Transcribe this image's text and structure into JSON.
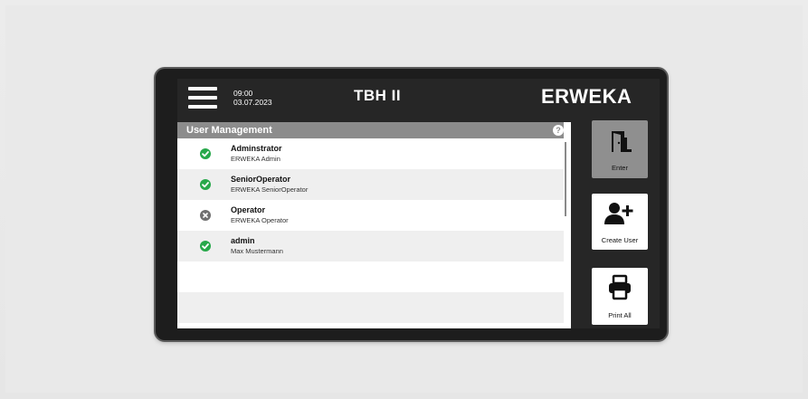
{
  "header": {
    "time": "09:00",
    "date": "03.07.2023",
    "title": "TBH II",
    "brand": "ERWEKA"
  },
  "list": {
    "title": "User Management",
    "help": "?",
    "users": [
      {
        "name": "Adminstrator",
        "role": "ERWEKA Admin",
        "status": "active"
      },
      {
        "name": "SeniorOperator",
        "role": "ERWEKA SeniorOperator",
        "status": "active"
      },
      {
        "name": "Operator",
        "role": "ERWEKA Operator",
        "status": "inactive"
      },
      {
        "name": "admin",
        "role": "Max Mustermann",
        "status": "active"
      }
    ]
  },
  "buttons": {
    "enter": "Enter",
    "create_user": "Create User",
    "print_all": "Print All"
  },
  "colors": {
    "active": "#27a84a",
    "inactive": "#6f6f6f",
    "header_bar": "#8c8c8c",
    "screen": "#262626"
  }
}
